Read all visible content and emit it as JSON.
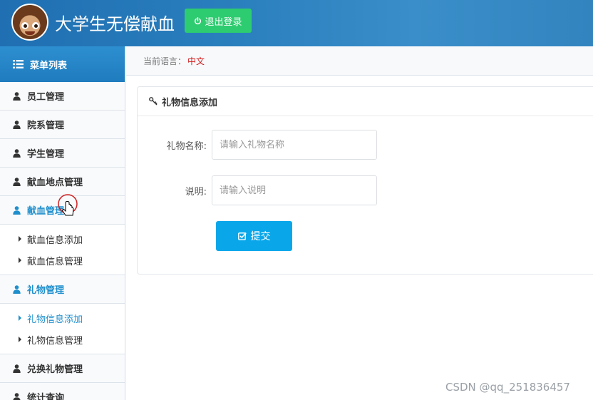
{
  "header": {
    "title": "大学生无偿献血",
    "logout_label": "退出登录"
  },
  "sidebar": {
    "title": "菜单列表",
    "items": [
      {
        "label": "员工管理"
      },
      {
        "label": "院系管理"
      },
      {
        "label": "学生管理"
      },
      {
        "label": "献血地点管理"
      },
      {
        "label": "献血管理",
        "sub": [
          "献血信息添加",
          "献血信息管理"
        ]
      },
      {
        "label": "礼物管理",
        "sub": [
          "礼物信息添加",
          "礼物信息管理"
        ]
      },
      {
        "label": "兑换礼物管理"
      },
      {
        "label": "统计查询"
      }
    ]
  },
  "breadcrumb": {
    "prefix": "当前语言：",
    "language": "中文"
  },
  "form": {
    "title": "礼物信息添加",
    "name_label": "礼物名称:",
    "name_placeholder": "请输入礼物名称",
    "desc_label": "说明:",
    "desc_placeholder": "请输入说明",
    "submit_label": "提交"
  },
  "watermark": "CSDN @qq_251836457",
  "colors": {
    "header_bg": "#2a7fbd",
    "logout_bg": "#2dcc70",
    "accent": "#1f8fcc",
    "submit_bg": "#09a7ea",
    "language_red": "#d31b1b"
  }
}
